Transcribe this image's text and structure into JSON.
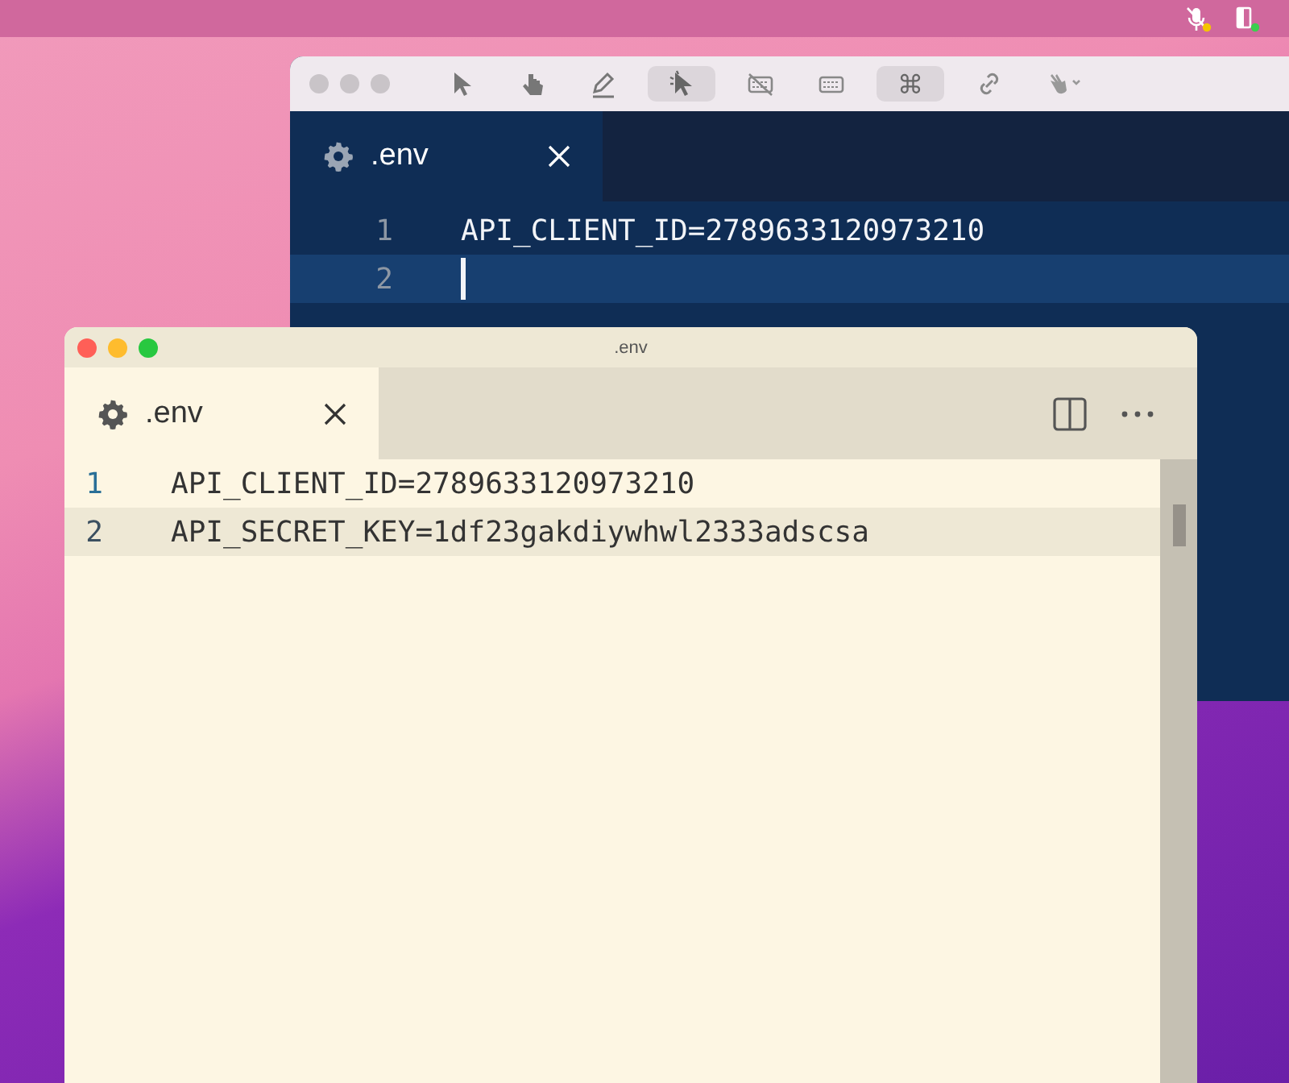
{
  "back_window": {
    "toolbar": [
      {
        "kind": "pointer",
        "on": false
      },
      {
        "kind": "hand",
        "on": false
      },
      {
        "kind": "pencil",
        "on": false
      },
      {
        "kind": "highlight-pointer",
        "on": true
      },
      {
        "kind": "keyboard-off",
        "on": false
      },
      {
        "kind": "keyboard",
        "on": false
      },
      {
        "kind": "command",
        "symbol": "⌘",
        "on": true
      },
      {
        "kind": "link",
        "on": false
      },
      {
        "kind": "waving-hand",
        "on": false
      }
    ],
    "tab": {
      "label": ".env"
    },
    "lines": [
      {
        "number": "1",
        "text": "API_CLIENT_ID=2789633120973210",
        "current": false
      },
      {
        "number": "2",
        "current": true
      }
    ]
  },
  "front_window": {
    "title": ".env",
    "tab": {
      "label": ".env"
    },
    "lines": [
      {
        "number": "1",
        "text": "API_CLIENT_ID=2789633120973210",
        "current": false
      },
      {
        "number": "2",
        "text": "API_SECRET_KEY=1df23gakdiywhwl2333adscsa",
        "current": true
      }
    ]
  }
}
